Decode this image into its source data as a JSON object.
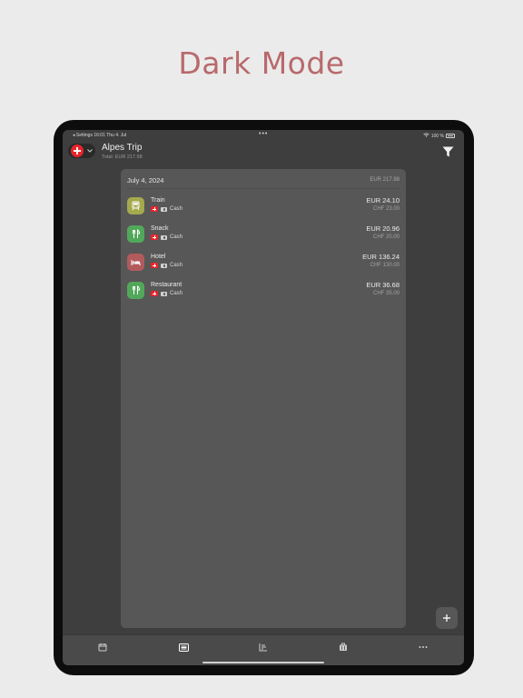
{
  "hero_title": "Dark Mode",
  "status": {
    "back": "◂ Settings",
    "time": "16:01",
    "date": "Thu 4. Jul",
    "battery": "100 %",
    "dots": "•••"
  },
  "nav": {
    "title": "Alpes Trip",
    "total": "Total: EUR 217.98"
  },
  "group": {
    "date": "July 4, 2024",
    "total": "EUR 217.98"
  },
  "expenses": [
    {
      "name": "Train",
      "payment": "Cash",
      "amount": "EUR 24.10",
      "original": "CHF 23.00",
      "category_icon": "train-icon",
      "color": "#a5a94d"
    },
    {
      "name": "Snack",
      "payment": "Cash",
      "amount": "EUR 20.96",
      "original": "CHF 20.00",
      "category_icon": "fork-knife-icon",
      "color": "#52a85a"
    },
    {
      "name": "Hotel",
      "payment": "Cash",
      "amount": "EUR 136.24",
      "original": "CHF 130.00",
      "category_icon": "bed-icon",
      "color": "#b35a5c"
    },
    {
      "name": "Restaurant",
      "payment": "Cash",
      "amount": "EUR 36.68",
      "original": "CHF 35.00",
      "category_icon": "fork-knife-icon",
      "color": "#52a85a"
    }
  ],
  "tabs": [
    {
      "name": "calendar-icon",
      "active": false
    },
    {
      "name": "list-icon",
      "active": true
    },
    {
      "name": "chart-icon",
      "active": false
    },
    {
      "name": "suitcase-icon",
      "active": false
    },
    {
      "name": "more-icon",
      "active": false
    }
  ],
  "colors": {
    "accent_text": "#b86a6c",
    "background": "#3e3e3e",
    "card": "#575757",
    "swiss_red": "#e8232a"
  }
}
